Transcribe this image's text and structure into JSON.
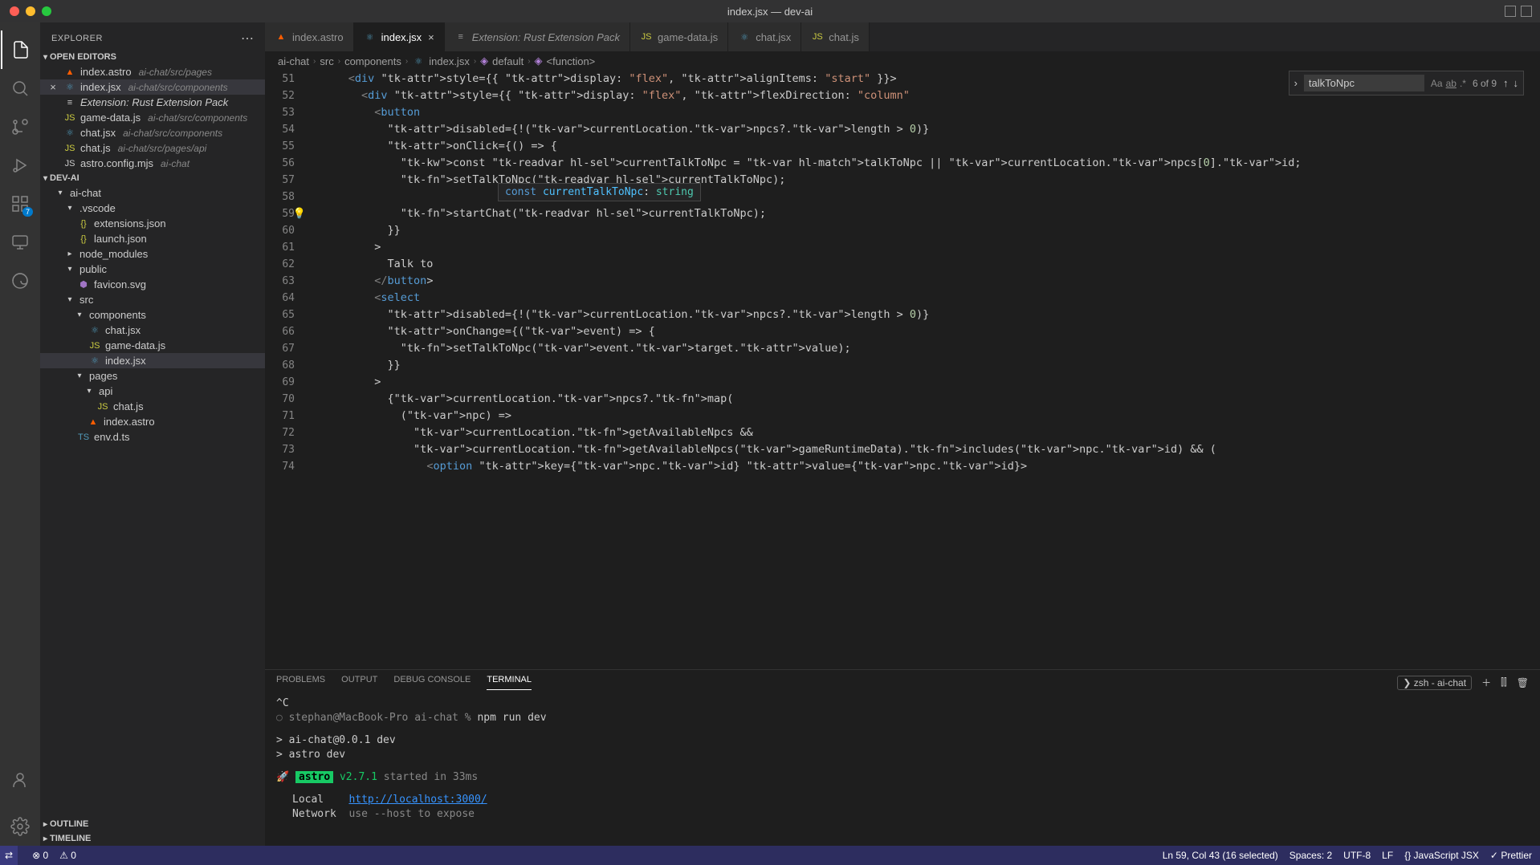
{
  "window": {
    "title": "index.jsx — dev-ai"
  },
  "sidebar": {
    "title": "EXPLORER",
    "sections": {
      "openEditors": "OPEN EDITORS",
      "project": "DEV-AI",
      "outline": "OUTLINE",
      "timeline": "TIMELINE"
    },
    "openEditors": [
      {
        "name": "index.astro",
        "path": "ai-chat/src/pages"
      },
      {
        "name": "index.jsx",
        "path": "ai-chat/src/components",
        "active": true
      },
      {
        "name": "Extension: Rust Extension Pack",
        "path": ""
      },
      {
        "name": "game-data.js",
        "path": "ai-chat/src/components"
      },
      {
        "name": "chat.jsx",
        "path": "ai-chat/src/components"
      },
      {
        "name": "chat.js",
        "path": "ai-chat/src/pages/api"
      },
      {
        "name": "astro.config.mjs",
        "path": "ai-chat"
      }
    ],
    "tree": {
      "aiChat": "ai-chat",
      "vscode": ".vscode",
      "extensionsJson": "extensions.json",
      "launchJson": "launch.json",
      "nodeModules": "node_modules",
      "public": "public",
      "favicon": "favicon.svg",
      "src": "src",
      "components": "components",
      "chatJsx": "chat.jsx",
      "gameDataJs": "game-data.js",
      "indexJsx": "index.jsx",
      "pages": "pages",
      "api": "api",
      "chatJs": "chat.js",
      "indexAstro": "index.astro",
      "envDts": "env.d.ts"
    }
  },
  "activityBadge": "7",
  "tabs": [
    {
      "label": "index.astro",
      "icon": "astro"
    },
    {
      "label": "index.jsx",
      "icon": "jsx",
      "active": true,
      "close": true
    },
    {
      "label": "Extension: Rust Extension Pack",
      "icon": "ext",
      "italic": true
    },
    {
      "label": "game-data.js",
      "icon": "js"
    },
    {
      "label": "chat.jsx",
      "icon": "jsx"
    },
    {
      "label": "chat.js",
      "icon": "js"
    }
  ],
  "breadcrumb": {
    "parts": [
      "ai-chat",
      "src",
      "components",
      "index.jsx",
      "default",
      "<function>"
    ]
  },
  "search": {
    "value": "talkToNpc",
    "count": "6 of 9"
  },
  "editor": {
    "startLine": 51,
    "hover": "const currentTalkToNpc: string",
    "lines": [
      "      <div style={{ display: \"flex\", alignItems: \"start\" }}>",
      "        <div style={{ display: \"flex\", flexDirection: \"column\"",
      "          <button",
      "            disabled={!(currentLocation.npcs?.length > 0)}",
      "            onClick={() => {",
      "              const currentTalkToNpc = talkToNpc || currentLocation.npcs[0].id;",
      "              setTalkToNpc(currentTalkToNpc);",
      "",
      "              startChat(currentTalkToNpc);",
      "            }}",
      "          >",
      "            Talk to",
      "          </button>",
      "          <select",
      "            disabled={!(currentLocation.npcs?.length > 0)}",
      "            onChange={(event) => {",
      "              setTalkToNpc(event.target.value);",
      "            }}",
      "          >",
      "            {currentLocation.npcs?.map(",
      "              (npc) =>",
      "                currentLocation.getAvailableNpcs &&",
      "                currentLocation.getAvailableNpcs(gameRuntimeData).includes(npc.id) && (",
      "                  <option key={npc.id} value={npc.id}>"
    ]
  },
  "panel": {
    "tabs": {
      "problems": "PROBLEMS",
      "output": "OUTPUT",
      "debug": "DEBUG CONSOLE",
      "terminal": "TERMINAL"
    },
    "shell": "zsh - ai-chat"
  },
  "terminal": {
    "l1": "^C",
    "l2a": "stephan@MacBook-Pro ai-chat % ",
    "l2b": "npm run dev",
    "l3": "> ai-chat@0.0.1 dev",
    "l4": "> astro dev",
    "astro": "astro",
    "version": "v2.7.1",
    "started": " started in 33ms",
    "localLabel": "Local",
    "localUrl": "http://localhost:3000/",
    "networkLabel": "Network",
    "networkHint": "use --host to expose"
  },
  "status": {
    "errors": "0",
    "warnings": "0",
    "cursor": "Ln 59, Col 43 (16 selected)",
    "spaces": "Spaces: 2",
    "encoding": "UTF-8",
    "eol": "LF",
    "lang": "JavaScript JSX",
    "prettier": "Prettier"
  }
}
